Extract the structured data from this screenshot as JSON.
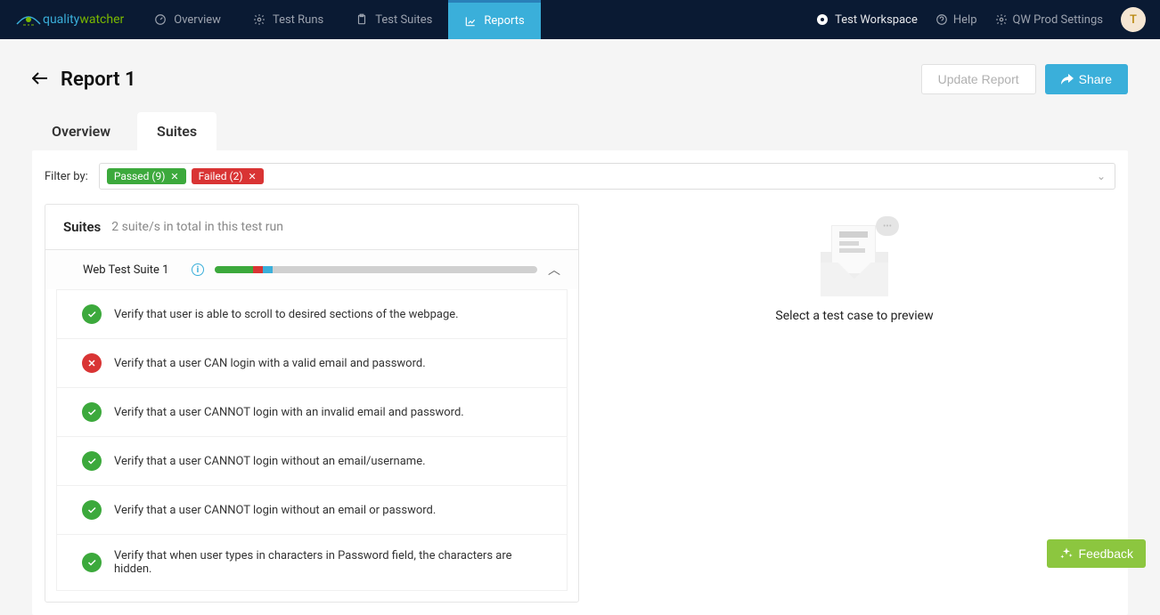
{
  "nav": {
    "overview": "Overview",
    "test_runs": "Test Runs",
    "test_suites": "Test Suites",
    "reports": "Reports",
    "workspace": "Test Workspace",
    "help": "Help",
    "settings": "QW Prod Settings",
    "avatar_initial": "T"
  },
  "page": {
    "title": "Report 1",
    "update_btn": "Update Report",
    "share_btn": "Share"
  },
  "tabs": {
    "overview": "Overview",
    "suites": "Suites"
  },
  "filter": {
    "label": "Filter by:",
    "passed_tag": "Passed (9)",
    "failed_tag": "Failed (2)"
  },
  "suites": {
    "title": "Suites",
    "count_text": "2 suite/s in total in this test run",
    "suite1_name": "Web Test Suite 1",
    "tests": [
      {
        "status": "passed",
        "name": "Verify that user is able to scroll to desired sections of the webpage."
      },
      {
        "status": "failed",
        "name": "Verify that a user CAN login with a valid email and password."
      },
      {
        "status": "passed",
        "name": "Verify that a user CANNOT login with an invalid email and password."
      },
      {
        "status": "passed",
        "name": "Verify that a user CANNOT login without an email/username."
      },
      {
        "status": "passed",
        "name": "Verify that a user CANNOT login without an email or password."
      },
      {
        "status": "passed",
        "name": "Verify that when user types in characters in Password field, the characters are hidden."
      }
    ]
  },
  "preview": {
    "empty_text": "Select a test case to preview"
  },
  "feedback": "Feedback"
}
